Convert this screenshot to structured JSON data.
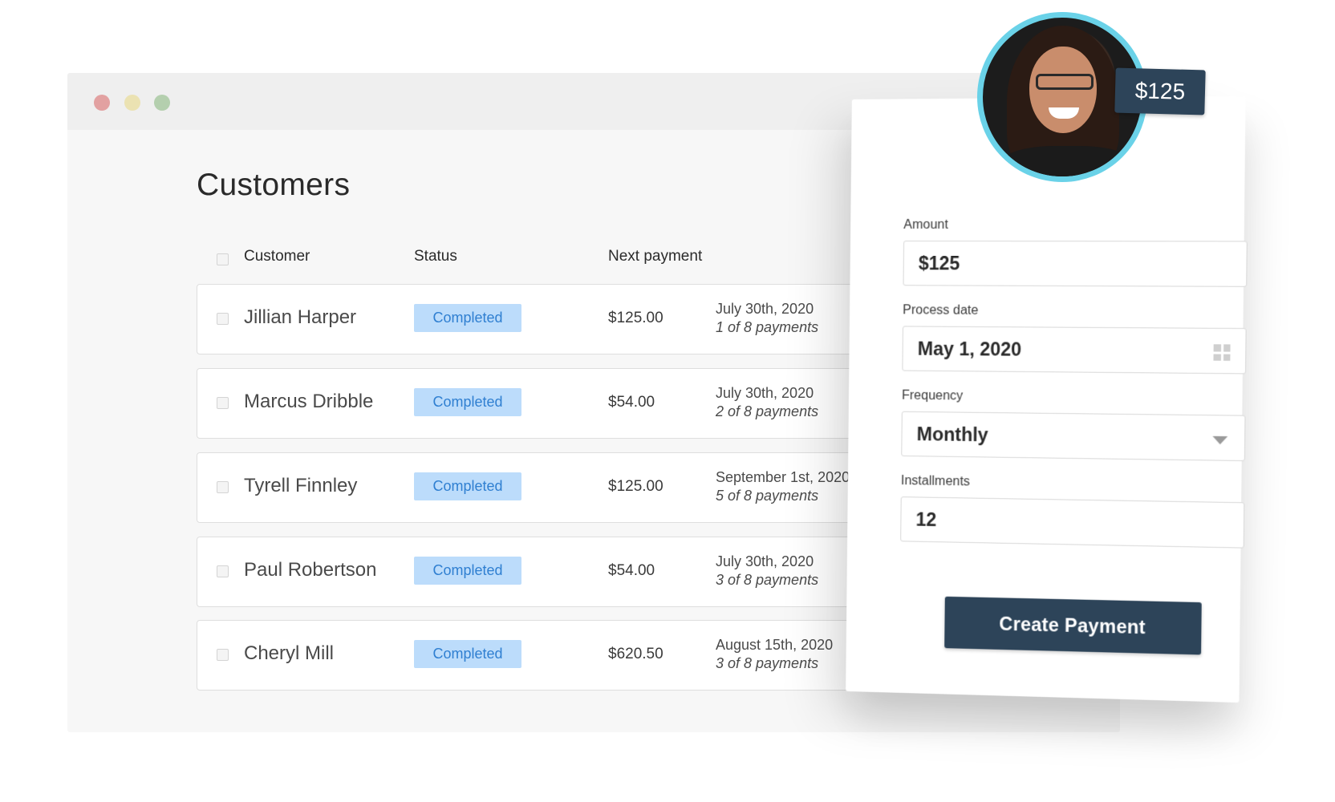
{
  "window": {
    "controls": [
      "close",
      "minimize",
      "maximize"
    ]
  },
  "page": {
    "title": "Customers"
  },
  "table": {
    "headers": {
      "customer": "Customer",
      "status": "Status",
      "next_payment": "Next payment"
    },
    "rows": [
      {
        "name": "Jillian Harper",
        "status": "Completed",
        "amount": "$125.00",
        "date": "July 30th, 2020",
        "count": "1 of 8 payments"
      },
      {
        "name": "Marcus Dribble",
        "status": "Completed",
        "amount": "$54.00",
        "date": "July 30th, 2020",
        "count": "2 of 8 payments"
      },
      {
        "name": "Tyrell Finnley",
        "status": "Completed",
        "amount": "$125.00",
        "date": "September 1st, 2020",
        "count": "5 of 8 payments"
      },
      {
        "name": "Paul Robertson",
        "status": "Completed",
        "amount": "$54.00",
        "date": "July 30th, 2020",
        "count": "3 of 8 payments"
      },
      {
        "name": "Cheryl Mill",
        "status": "Completed",
        "amount": "$620.50",
        "date": "August 15th, 2020",
        "count": "3 of 8 payments"
      }
    ]
  },
  "payment_form": {
    "price_tag": "$125",
    "amount": {
      "label": "Amount",
      "value": "$125"
    },
    "process_date": {
      "label": "Process date",
      "value": "May 1, 2020",
      "icon": "calendar-grid-icon"
    },
    "frequency": {
      "label": "Frequency",
      "value": "Monthly",
      "icon": "chevron-down-icon"
    },
    "installments": {
      "label": "Installments",
      "value": "12"
    },
    "submit_label": "Create Payment"
  },
  "colors": {
    "badge_bg": "#bcdcfb",
    "badge_text": "#2f7fd1",
    "button_bg": "#2d4459",
    "avatar_ring": "#6ad2e8"
  }
}
